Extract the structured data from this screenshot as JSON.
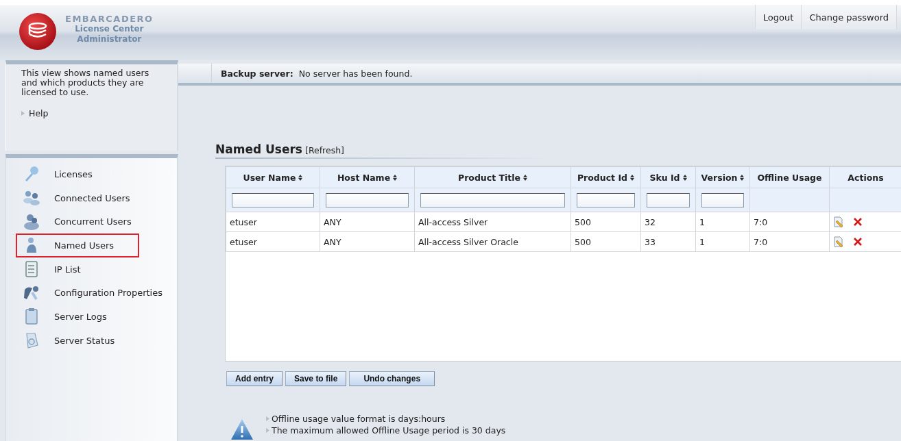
{
  "header": {
    "brand": "EMBARCADERO",
    "product_lines": [
      "License Center",
      "Administrator"
    ],
    "links": [
      "Logout",
      "Change password"
    ]
  },
  "sidebar": {
    "description": "This view shows named users and which products they are licensed to use.",
    "help_link": "Help",
    "items": [
      {
        "label": "Licenses",
        "selected": false
      },
      {
        "label": "Connected Users",
        "selected": false
      },
      {
        "label": "Concurrent Users",
        "selected": false
      },
      {
        "label": "Named Users",
        "selected": true
      },
      {
        "label": "IP List",
        "selected": false
      },
      {
        "label": "Configuration Properties",
        "selected": false
      },
      {
        "label": "Server Logs",
        "selected": false
      },
      {
        "label": "Server Status",
        "selected": false
      }
    ]
  },
  "backup_bar": {
    "label": "Backup server:",
    "value": "No server has been found."
  },
  "section": {
    "title": "Named Users",
    "refresh_link": "[Refresh]"
  },
  "table": {
    "columns": [
      {
        "label": "User Name",
        "sortable": true,
        "filter": true
      },
      {
        "label": "Host Name",
        "sortable": true,
        "filter": true
      },
      {
        "label": "Product Title",
        "sortable": true,
        "filter": true
      },
      {
        "label": "Product Id",
        "sortable": true,
        "filter": true
      },
      {
        "label": "Sku Id",
        "sortable": true,
        "filter": true
      },
      {
        "label": "Version",
        "sortable": true,
        "filter": true
      },
      {
        "label": "Offline Usage",
        "sortable": false,
        "filter": false
      },
      {
        "label": "Actions",
        "sortable": false,
        "filter": false
      }
    ],
    "rows": [
      [
        "etuser",
        "ANY",
        "All-access Silver",
        "500",
        "32",
        "1",
        "7:0"
      ],
      [
        "etuser",
        "ANY",
        "All-access Silver Oracle",
        "500",
        "33",
        "1",
        "7:0"
      ]
    ]
  },
  "buttons": [
    "Add entry",
    "Save to file",
    "Undo changes"
  ],
  "notes": [
    "Offline usage value format is days:hours",
    "The maximum allowed Offline Usage period is 30 days"
  ]
}
